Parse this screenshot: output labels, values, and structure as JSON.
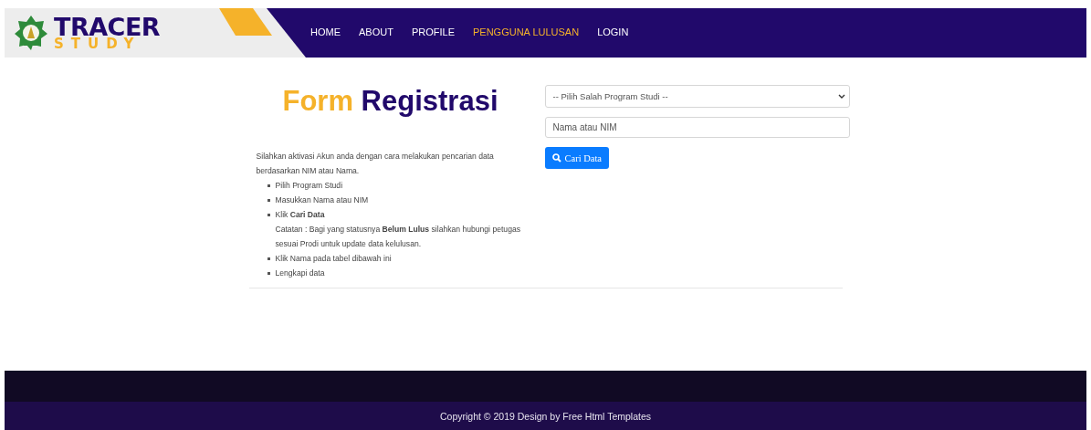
{
  "logo": {
    "line_1": "TRACER",
    "line_2": "STUDY"
  },
  "nav": [
    {
      "label": "HOME",
      "selected": false
    },
    {
      "label": "ABOUT",
      "selected": false
    },
    {
      "label": "PROFILE",
      "selected": false
    },
    {
      "label": "PENGGUNA LULUSAN",
      "selected": true
    },
    {
      "label": "LOGIN",
      "selected": false
    }
  ],
  "title": {
    "part_1": "Form",
    "part_2": "Registrasi"
  },
  "intro": "Silahkan aktivasi Akun anda dengan cara melakukan pencarian data berdasarkan NIM atau Nama.",
  "steps": [
    {
      "text": "Pilih Program Studi"
    },
    {
      "text": "Masukkan Nama atau NIM"
    },
    {
      "text": "Klik **Cari Data**",
      "note": "Catatan : Bagi yang statusnya **Belum Lulus** silahkan hubungi petugas sesuai Prodi untuk update data kelulusan."
    },
    {
      "text": "Klik Nama pada tabel dibawah ini"
    },
    {
      "text": "Lengkapi data"
    }
  ],
  "program_select": {
    "value": "-- Pilih Salah Program Studi --"
  },
  "name_field": {
    "placeholder": "Nama atau NIM"
  },
  "search_button": "Cari Data",
  "footer": "Copyright © 2019 Design by Free Html Templates"
}
